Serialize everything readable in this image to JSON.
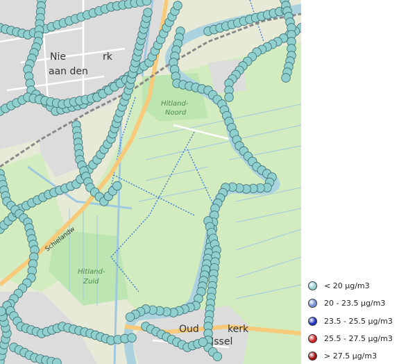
{
  "map": {
    "place_labels": {
      "nieuwerkerk_line1": "Nie",
      "nieuwerkerk_line1b": "rk",
      "nieuwerkerk_line2": "aan den",
      "hitland_noord_1": "Hitland-",
      "hitland_noord_2": "Noord",
      "hitland_zuid_1": "Hitland-",
      "hitland_zuid_2": "Zuid",
      "ouderkerk_1": "Oud",
      "ouderkerk_1b": "kerk",
      "ouderkerk_2": "IJssel",
      "schielandweg": "Schielandw"
    },
    "colors": {
      "land": "#e8ead8",
      "meadow": "#d3ecbf",
      "nature": "#bde5b1",
      "urban": "#dcdcdc",
      "water": "#aad3df",
      "canal": "#9ec8e0",
      "road_main": "#f7c97a",
      "road_minor": "#ffffff",
      "rail": "#888888",
      "cycle_path": "#3c78d8",
      "marker": "#8fd0cf",
      "marker_stroke": "#3d6b6e"
    }
  },
  "legend": {
    "items": [
      {
        "label": "< 20 µg/m3",
        "color": "#8fd0cf"
      },
      {
        "label": "20 - 23.5 µg/m3",
        "color": "#6f8fd0"
      },
      {
        "label": "23.5 - 25.5 µg/m3",
        "color": "#1b2fc0"
      },
      {
        "label": "25.5 - 27.5 µg/m3",
        "color": "#cc2222"
      },
      {
        "label": "> 27.5 µg/m3",
        "color": "#a00d0d"
      }
    ]
  }
}
